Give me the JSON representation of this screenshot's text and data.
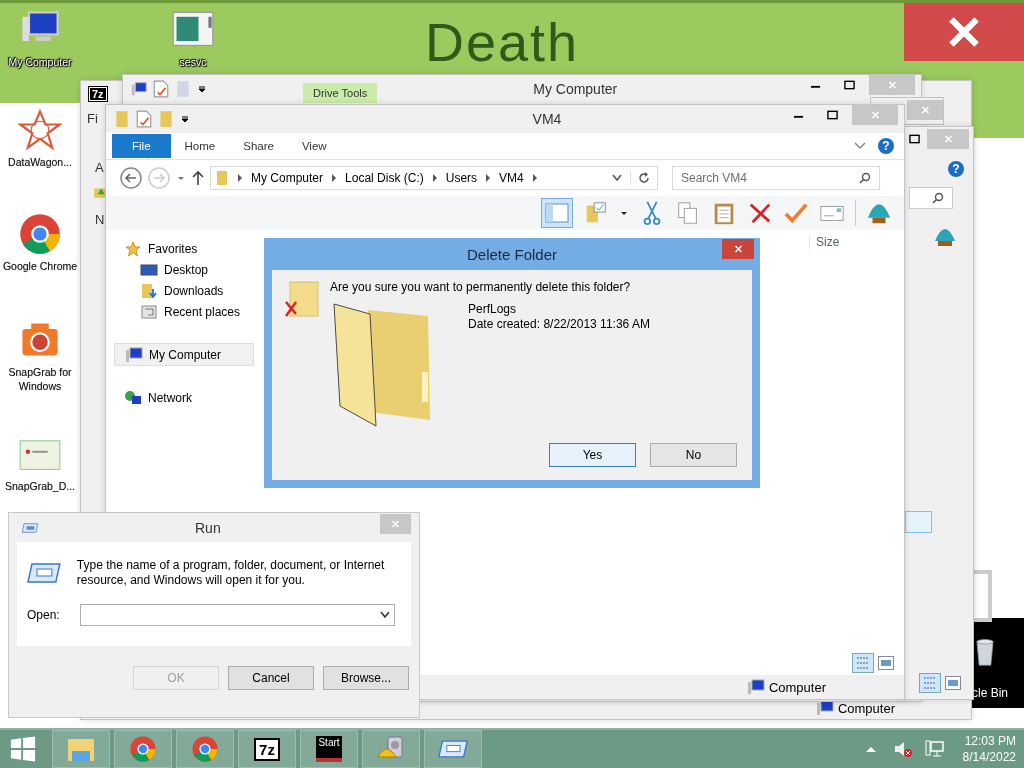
{
  "wallpaper": {
    "text": "Death"
  },
  "desktop_icons": [
    {
      "label": "My Computer",
      "kind": "computer"
    },
    {
      "label": "sesvc",
      "kind": "window"
    },
    {
      "label": "DataWagon...",
      "kind": "star"
    },
    {
      "label": "Google Chrome",
      "kind": "chrome"
    },
    {
      "label": "SnapGrab for Windows",
      "kind": "camera"
    },
    {
      "label": "SnapGrab_D...",
      "kind": "shot"
    }
  ],
  "recycle_bin": {
    "label": "cle Bin"
  },
  "archive_window": {
    "icon_glyph": "7z",
    "fragments": [
      "Fi",
      "A",
      "N"
    ]
  },
  "right_window": {
    "help_glyph": "?",
    "status": "Computer"
  },
  "my_computer_window": {
    "title": "My Computer",
    "context_tab": "Drive Tools"
  },
  "explorer": {
    "title": "VM4",
    "tabs": [
      {
        "label": "File",
        "selected": true
      },
      {
        "label": "Home",
        "selected": false
      },
      {
        "label": "Share",
        "selected": false
      },
      {
        "label": "View",
        "selected": false
      }
    ],
    "path": [
      "My Computer",
      "Local Disk (C:)",
      "Users",
      "VM4"
    ],
    "search_placeholder": "Search VM4",
    "nav": [
      {
        "label": "Favorites",
        "kind": "star",
        "selected": false,
        "children": [
          {
            "label": "Desktop",
            "kind": "desktop",
            "selected": false
          },
          {
            "label": "Downloads",
            "kind": "downloads",
            "selected": false
          },
          {
            "label": "Recent places",
            "kind": "recent",
            "selected": false
          }
        ]
      },
      {
        "label": "My Computer",
        "kind": "computer",
        "selected": true
      },
      {
        "label": "Network",
        "kind": "network",
        "selected": false
      }
    ],
    "columns": [
      "Size"
    ],
    "help_glyph": "?",
    "status": "Computer"
  },
  "delete_dialog": {
    "title": "Delete Folder",
    "question": "Are you sure you want to permanently delete this folder?",
    "item_name": "PerfLogs",
    "item_date": "Date created: 8/22/2013 11:36 AM",
    "buttons": [
      {
        "label": "Yes",
        "selected": true
      },
      {
        "label": "No",
        "selected": false
      }
    ]
  },
  "run_dialog": {
    "title": "Run",
    "description": "Type the name of a program, folder, document, or Internet resource, and Windows will open it for you.",
    "open_label": "Open:",
    "buttons": [
      {
        "label": "OK",
        "disabled": true
      },
      {
        "label": "Cancel",
        "disabled": false
      },
      {
        "label": "Browse...",
        "disabled": false
      }
    ]
  },
  "taskbar": {
    "apps": [
      {
        "kind": "explorer"
      },
      {
        "kind": "chrome"
      },
      {
        "kind": "chrome"
      },
      {
        "kind": "archiver",
        "glyph": "7z"
      },
      {
        "kind": "terminal",
        "glyph": "Start"
      },
      {
        "kind": "disk"
      },
      {
        "kind": "run"
      }
    ],
    "time": "12:03 PM",
    "date": "8/14/2022"
  }
}
